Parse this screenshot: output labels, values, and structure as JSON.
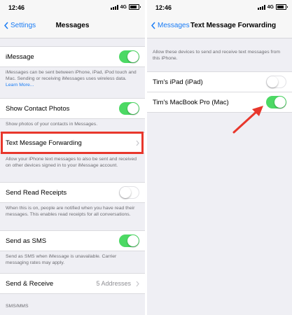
{
  "left": {
    "status": {
      "time": "12:46",
      "network": "4G"
    },
    "nav": {
      "back": "Settings",
      "title": "Messages"
    },
    "imessage": {
      "label": "iMessage",
      "footer": "iMessages can be sent between iPhone, iPad, iPod touch and Mac. Sending or receiving iMessages uses wireless data.",
      "footer_link": "Learn More..."
    },
    "contact_photos": {
      "label": "Show Contact Photos",
      "footer": "Show photos of your contacts in Messages."
    },
    "text_forwarding": {
      "label": "Text Message Forwarding",
      "footer": "Allow your iPhone text messages to also be sent and received on other devices signed in to your iMessage account."
    },
    "read_receipts": {
      "label": "Send Read Receipts",
      "footer": "When this is on, people are notified when you have read their messages. This enables read receipts for all conversations."
    },
    "send_sms": {
      "label": "Send as SMS",
      "footer": "Send as SMS when iMessage is unavailable. Carrier messaging rates may apply."
    },
    "send_receive": {
      "label": "Send & Receive",
      "value": "5 Addresses"
    },
    "sms_header": "SMS/MMS"
  },
  "right": {
    "status": {
      "time": "12:46",
      "network": "4G"
    },
    "nav": {
      "back": "Messages",
      "title": "Text Message Forwarding"
    },
    "description": "Allow these devices to send and receive text messages from this iPhone.",
    "devices": [
      {
        "label": "Tim's iPad (iPad)",
        "enabled": false
      },
      {
        "label": "Tim's MacBook Pro (Mac)",
        "enabled": true
      }
    ]
  },
  "colors": {
    "accent": "#1a7cf5",
    "toggle_on": "#4cd964",
    "highlight": "#e8372c"
  }
}
